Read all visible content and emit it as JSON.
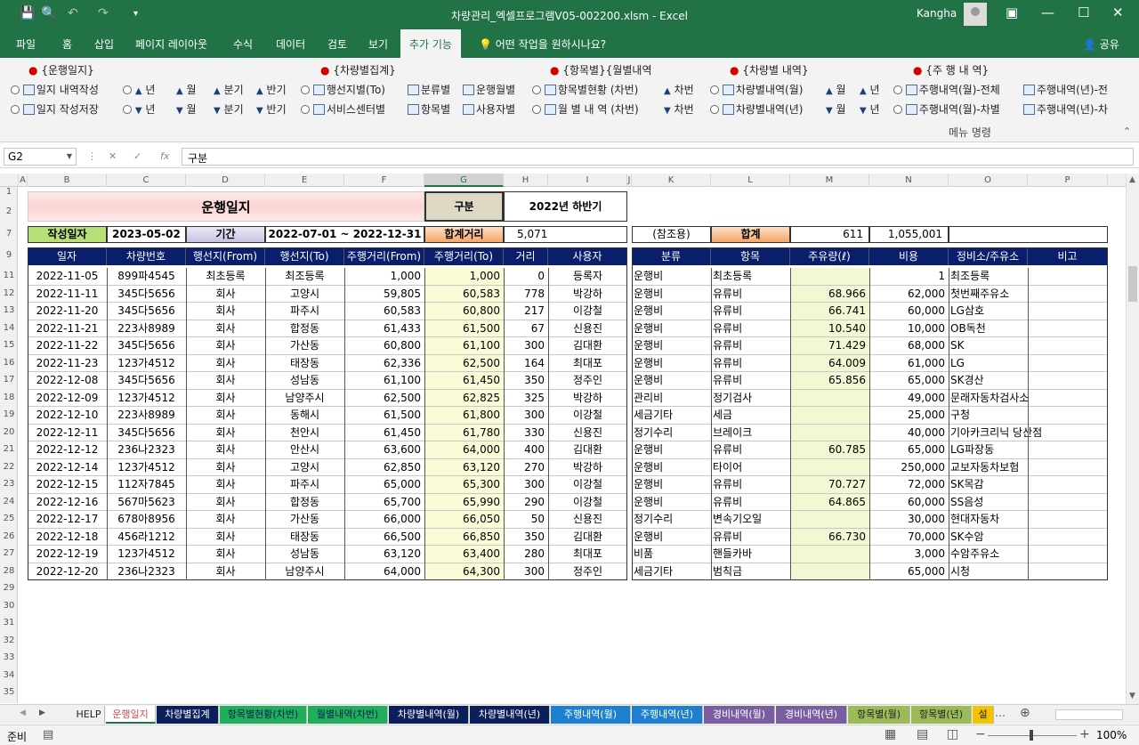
{
  "window": {
    "title": "차량관리_엑셀프로그램V05-002200.xlsm  -  Excel",
    "user": "Kangha"
  },
  "ribbon_tabs": [
    "파일",
    "홈",
    "삽입",
    "페이지 레이아웃",
    "수식",
    "데이터",
    "검토",
    "보기",
    "추가 기능"
  ],
  "tell_me": "어떤 작업을 원하시나요?",
  "share": "공유",
  "ribbon": {
    "groups": [
      "{운행일지}",
      "{차량별집계}",
      "{항목별}{월별내역",
      "{차량별 내역}",
      "{주 행 내 역}"
    ],
    "row1": [
      "일지 내역작성",
      "년",
      "월",
      "분기",
      "반기",
      "행선지별(To)",
      "분류별",
      "운행월별",
      "항목별현황 (차번)",
      "차번",
      "차량별내역(월)",
      "월",
      "년",
      "주행내역(월)-전체",
      "주행내역(년)-전"
    ],
    "row2": [
      "일지 작성저장",
      "년",
      "월",
      "분기",
      "반기",
      "서비스센터별",
      "항목별",
      "사용자별",
      "월 별 내 역 (차번)",
      "차번",
      "차량별내역(년)",
      "월",
      "년",
      "주행내역(월)-차별",
      "주행내역(년)-차"
    ],
    "menu_label": "메뉴 명령"
  },
  "name_box": "G2",
  "formula": "구분",
  "columns": [
    "A",
    "B",
    "C",
    "D",
    "E",
    "F",
    "G",
    "H",
    "I",
    "J",
    "K",
    "L",
    "M",
    "N",
    "O",
    "P"
  ],
  "rows": [
    "1",
    "2",
    "7",
    "9",
    "11",
    "12",
    "13",
    "14",
    "15",
    "16",
    "17",
    "18",
    "19",
    "20",
    "21",
    "22",
    "23",
    "24",
    "25",
    "26",
    "27",
    "28",
    "29",
    "30",
    "31",
    "32",
    "33",
    "34",
    "35"
  ],
  "sheet": {
    "title": "운행일지",
    "gubun_label": "구분",
    "gubun_value": "2022년 하반기",
    "write_date_label": "작성일자",
    "write_date": "2023-05-02",
    "period_label": "기간",
    "period": "2022-07-01  ~ 2022-12-31",
    "total_dist_label": "합계거리",
    "total_dist": "5,071",
    "ref_label": "(참조용)",
    "sum_label": "합계",
    "sum_fuel": "611",
    "sum_cost": "1,055,001",
    "left_headers": [
      "일자",
      "차량번호",
      "행선지(From)",
      "행선지(To)",
      "주행거리(From)",
      "주행거리(To)",
      "거리",
      "사용자"
    ],
    "right_headers": [
      "분류",
      "항목",
      "주유량(ℓ)",
      "비용",
      "정비소/주유소",
      "비고"
    ],
    "left_rows": [
      [
        "2022-11-05",
        "899파4545",
        "최초등록",
        "최조등록",
        "1,000",
        "1,000",
        "0",
        "등록자"
      ],
      [
        "2022-11-11",
        "345다5656",
        "회사",
        "고양시",
        "59,805",
        "60,583",
        "778",
        "박강하"
      ],
      [
        "2022-11-20",
        "345다5656",
        "회사",
        "파주시",
        "60,583",
        "60,800",
        "217",
        "이강철"
      ],
      [
        "2022-11-21",
        "223사8989",
        "회사",
        "합정동",
        "61,433",
        "61,500",
        "67",
        "신용진"
      ],
      [
        "2022-11-22",
        "345다5656",
        "회사",
        "가산동",
        "60,800",
        "61,100",
        "300",
        "김대환"
      ],
      [
        "2022-11-23",
        "123가4512",
        "회사",
        "태장동",
        "62,336",
        "62,500",
        "164",
        "최대포"
      ],
      [
        "2022-12-08",
        "345다5656",
        "회사",
        "성남동",
        "61,100",
        "61,450",
        "350",
        "정주인"
      ],
      [
        "2022-12-09",
        "123가4512",
        "회사",
        "남양주시",
        "62,500",
        "62,825",
        "325",
        "박강하"
      ],
      [
        "2022-12-10",
        "223사8989",
        "회사",
        "동해시",
        "61,500",
        "61,800",
        "300",
        "이강철"
      ],
      [
        "2022-12-11",
        "345다5656",
        "회사",
        "천안시",
        "61,450",
        "61,780",
        "330",
        "신용진"
      ],
      [
        "2022-12-12",
        "236나2323",
        "회사",
        "안산시",
        "63,600",
        "64,000",
        "400",
        "김대환"
      ],
      [
        "2022-12-14",
        "123가4512",
        "회사",
        "고양시",
        "62,850",
        "63,120",
        "270",
        "박강하"
      ],
      [
        "2022-12-15",
        "112자7845",
        "회사",
        "파주시",
        "65,000",
        "65,300",
        "300",
        "이강철"
      ],
      [
        "2022-12-16",
        "567마5623",
        "회사",
        "합정동",
        "65,700",
        "65,990",
        "290",
        "이강철"
      ],
      [
        "2022-12-17",
        "678아8956",
        "회사",
        "가산동",
        "66,000",
        "66,050",
        "50",
        "신용진"
      ],
      [
        "2022-12-18",
        "456라1212",
        "회사",
        "태장동",
        "66,500",
        "66,850",
        "350",
        "김대환"
      ],
      [
        "2022-12-19",
        "123가4512",
        "회사",
        "성남동",
        "63,120",
        "63,400",
        "280",
        "최대포"
      ],
      [
        "2022-12-20",
        "236나2323",
        "회사",
        "남양주시",
        "64,000",
        "64,300",
        "300",
        "정주인"
      ]
    ],
    "right_rows": [
      [
        "운행비",
        "최초등록",
        "",
        "1",
        "최조등록"
      ],
      [
        "운행비",
        "유류비",
        "68.966",
        "62,000",
        "첫번째주유소"
      ],
      [
        "운행비",
        "유류비",
        "66.741",
        "60,000",
        "LG삼호"
      ],
      [
        "운행비",
        "유류비",
        "10.540",
        "10,000",
        "OB독천"
      ],
      [
        "운행비",
        "유류비",
        "71.429",
        "68,000",
        "SK"
      ],
      [
        "운행비",
        "유류비",
        "64.009",
        "61,000",
        "LG"
      ],
      [
        "운행비",
        "유류비",
        "65.856",
        "65,000",
        "SK경산"
      ],
      [
        "관리비",
        "정기검사",
        "",
        "49,000",
        "문래자동차검사소"
      ],
      [
        "세금기타",
        "세금",
        "",
        "25,000",
        "구청"
      ],
      [
        "정기수리",
        "브레이크",
        "",
        "40,000",
        "기아카크리닉 당산점"
      ],
      [
        "운행비",
        "유류비",
        "60.785",
        "65,000",
        "LG파장동"
      ],
      [
        "운행비",
        "타이어",
        "",
        "250,000",
        "교보자동차보험"
      ],
      [
        "운행비",
        "유류비",
        "70.727",
        "72,000",
        "SK목감"
      ],
      [
        "운행비",
        "유류비",
        "64.865",
        "60,000",
        "SS음성"
      ],
      [
        "정기수리",
        "변속기오일",
        "",
        "30,000",
        "현대자동차"
      ],
      [
        "운행비",
        "유류비",
        "66.730",
        "70,000",
        "SK수암"
      ],
      [
        "비품",
        "핸들카바",
        "",
        "3,000",
        "수암주유소"
      ],
      [
        "세금기타",
        "범칙금",
        "",
        "65,000",
        "시청"
      ]
    ]
  },
  "sheet_tabs": [
    {
      "label": "HELP",
      "bg": "#f0f0f0",
      "fg": "#222"
    },
    {
      "label": "운행일지",
      "bg": "#ffffff",
      "fg": "#c0504d"
    },
    {
      "label": "차량별집계",
      "bg": "#0a1f5c",
      "fg": "#ffffff"
    },
    {
      "label": "항목별현황(차번)",
      "bg": "#1fae5a",
      "fg": "#0a1f5c"
    },
    {
      "label": "월별내역(차번)",
      "bg": "#1fae5a",
      "fg": "#0a1f5c"
    },
    {
      "label": "차량별내역(월)",
      "bg": "#0a1f5c",
      "fg": "#ffffff"
    },
    {
      "label": "차량별내역(년)",
      "bg": "#0a1f5c",
      "fg": "#ffffff"
    },
    {
      "label": "주행내역(월)",
      "bg": "#1e7fd0",
      "fg": "#ffffff"
    },
    {
      "label": "주행내역(년)",
      "bg": "#1e7fd0",
      "fg": "#ffffff"
    },
    {
      "label": "경비내역(월)",
      "bg": "#7a5ca0",
      "fg": "#ffffff"
    },
    {
      "label": "경비내역(년)",
      "bg": "#7a5ca0",
      "fg": "#ffffff"
    },
    {
      "label": "항목별(월)",
      "bg": "#9bbb59",
      "fg": "#222"
    },
    {
      "label": "항목별(년)",
      "bg": "#9bbb59",
      "fg": "#222"
    },
    {
      "label": "설",
      "bg": "#f5c400",
      "fg": "#222"
    }
  ],
  "status": {
    "ready": "준비",
    "zoom": "100%"
  }
}
